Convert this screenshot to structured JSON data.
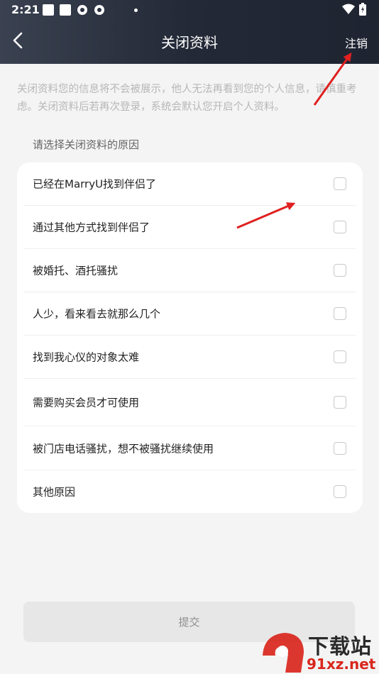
{
  "status_bar": {
    "time": "2:21"
  },
  "nav": {
    "title": "关闭资料",
    "action": "注销"
  },
  "notice": "关闭资料您的信息将不会被展示，他人无法再看到您的个人信息，请慎重考虑。关闭资料后若再次登录，系统会默认您开启个人资料。",
  "section_label": "请选择关闭资料的原因",
  "reasons": [
    {
      "label": "已经在MarryU找到伴侣了",
      "checked": false
    },
    {
      "label": "通过其他方式找到伴侣了",
      "checked": false
    },
    {
      "label": "被婚托、酒托骚扰",
      "checked": false
    },
    {
      "label": "人少，看来看去就那么几个",
      "checked": false
    },
    {
      "label": "找到我心仪的对象太难",
      "checked": false
    },
    {
      "label": "需要购买会员才可使用",
      "checked": false
    },
    {
      "label": "被门店电话骚扰，想不被骚扰继续使用",
      "checked": false
    },
    {
      "label": "其他原因",
      "checked": false
    }
  ],
  "submit_label": "提交",
  "watermark": {
    "brand": "下载站",
    "url": "91xz.net"
  },
  "colors": {
    "header_dark": "#232937",
    "annotation_arrow": "#e02020",
    "watermark_red": "#d9261c"
  }
}
